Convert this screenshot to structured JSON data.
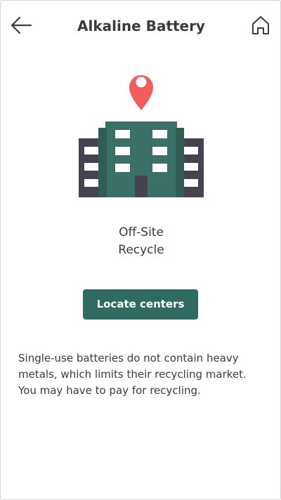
{
  "header": {
    "title": "Alkaline Battery"
  },
  "icons": {
    "back": "arrow-left-icon",
    "home": "home-icon",
    "illustration": "building-with-location-pin"
  },
  "main": {
    "method_line1": "Off-Site",
    "method_line2": "Recycle",
    "locate_button_label": "Locate centers",
    "description": "Single-use batteries do not contain heavy metals, which limits their recycling market. You may have to pay for recycling."
  },
  "colors": {
    "accent": "#2f6b63",
    "building_main": "#3a7068",
    "building_side": "#464250",
    "pin": "#f25c5c",
    "text": "#3b3b3b"
  }
}
